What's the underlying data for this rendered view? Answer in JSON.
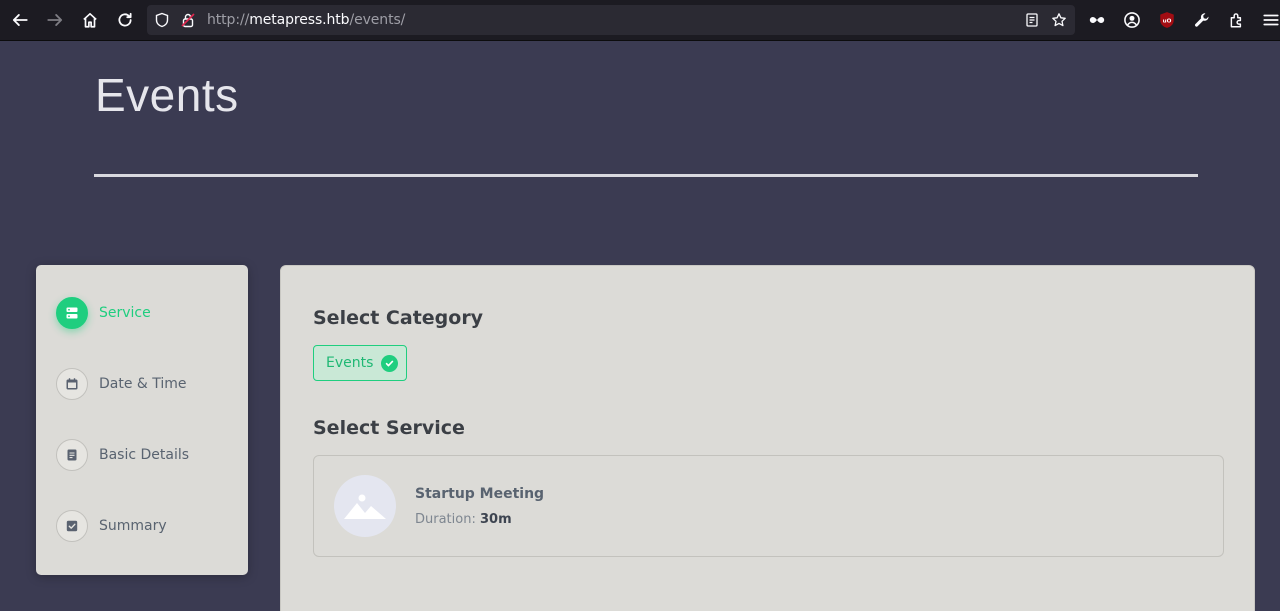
{
  "browser": {
    "url_scheme": "http://",
    "url_host": "metapress.htb",
    "url_path": "/events/",
    "icons": [
      "back-arrow-icon",
      "forward-arrow-icon",
      "home-icon",
      "reload-icon",
      "shield-icon",
      "insecure-lock-icon",
      "reader-mode-icon",
      "bookmark-star-icon",
      "infinity-icon",
      "account-icon",
      "ublock-icon",
      "wrench-icon",
      "extensions-icon",
      "menu-icon"
    ]
  },
  "page": {
    "title": "Events"
  },
  "steps": [
    {
      "label": "Service",
      "icon": "server-icon",
      "active": true
    },
    {
      "label": "Date & Time",
      "icon": "calendar-icon",
      "active": false
    },
    {
      "label": "Basic Details",
      "icon": "document-icon",
      "active": false
    },
    {
      "label": "Summary",
      "icon": "check-square-icon",
      "active": false
    }
  ],
  "category": {
    "heading": "Select Category",
    "selected": "Events"
  },
  "service": {
    "heading": "Select Service",
    "items": [
      {
        "name": "Startup Meeting",
        "duration_label": "Duration:",
        "duration_value": "30m",
        "icon": "image-placeholder-icon"
      }
    ]
  },
  "colors": {
    "accent": "#1fce7f",
    "background": "#3b3b52",
    "card": "#dcdbd7"
  }
}
